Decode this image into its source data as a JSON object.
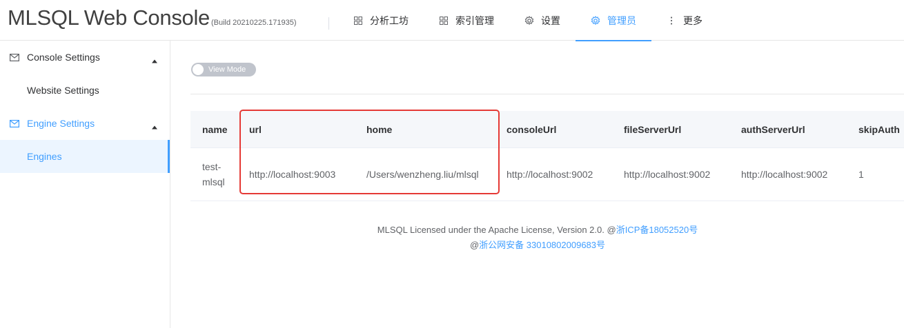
{
  "header": {
    "title": "MLSQL Web Console",
    "build": "(Build 20210225.171935)",
    "nav": [
      {
        "label": "分析工坊",
        "icon": "grid-icon"
      },
      {
        "label": "索引管理",
        "icon": "grid-icon"
      },
      {
        "label": "设置",
        "icon": "gear-icon"
      },
      {
        "label": "管理员",
        "icon": "gear-icon",
        "active": true
      },
      {
        "label": "更多",
        "icon": "more-vertical-icon"
      }
    ]
  },
  "sidebar": {
    "groups": [
      {
        "label": "Console Settings",
        "icon": "mail-icon",
        "items": [
          {
            "label": "Website Settings"
          }
        ]
      },
      {
        "label": "Engine Settings",
        "icon": "mail-icon",
        "active": true,
        "items": [
          {
            "label": "Engines",
            "selected": true
          }
        ]
      }
    ]
  },
  "main": {
    "switch_label": "View Mode",
    "table": {
      "columns": [
        "name",
        "url",
        "home",
        "consoleUrl",
        "fileServerUrl",
        "authServerUrl",
        "skipAuth"
      ],
      "rows": [
        {
          "name": "test-mlsql",
          "url": "http://localhost:9003",
          "home": "/Users/wenzheng.liu/mlsql",
          "consoleUrl": "http://localhost:9002",
          "fileServerUrl": "http://localhost:9002",
          "authServerUrl": "http://localhost:9002",
          "skipAuth": "1"
        }
      ]
    }
  },
  "footer": {
    "license_text": "MLSQL Licensed under the Apache License, Version 2.0. @",
    "icp_link": "浙ICP备18052520号",
    "police_prefix": "@",
    "police_link": "浙公网安备 33010802009683号"
  },
  "colors": {
    "accent": "#409eff",
    "highlight_box": "#e53935"
  }
}
